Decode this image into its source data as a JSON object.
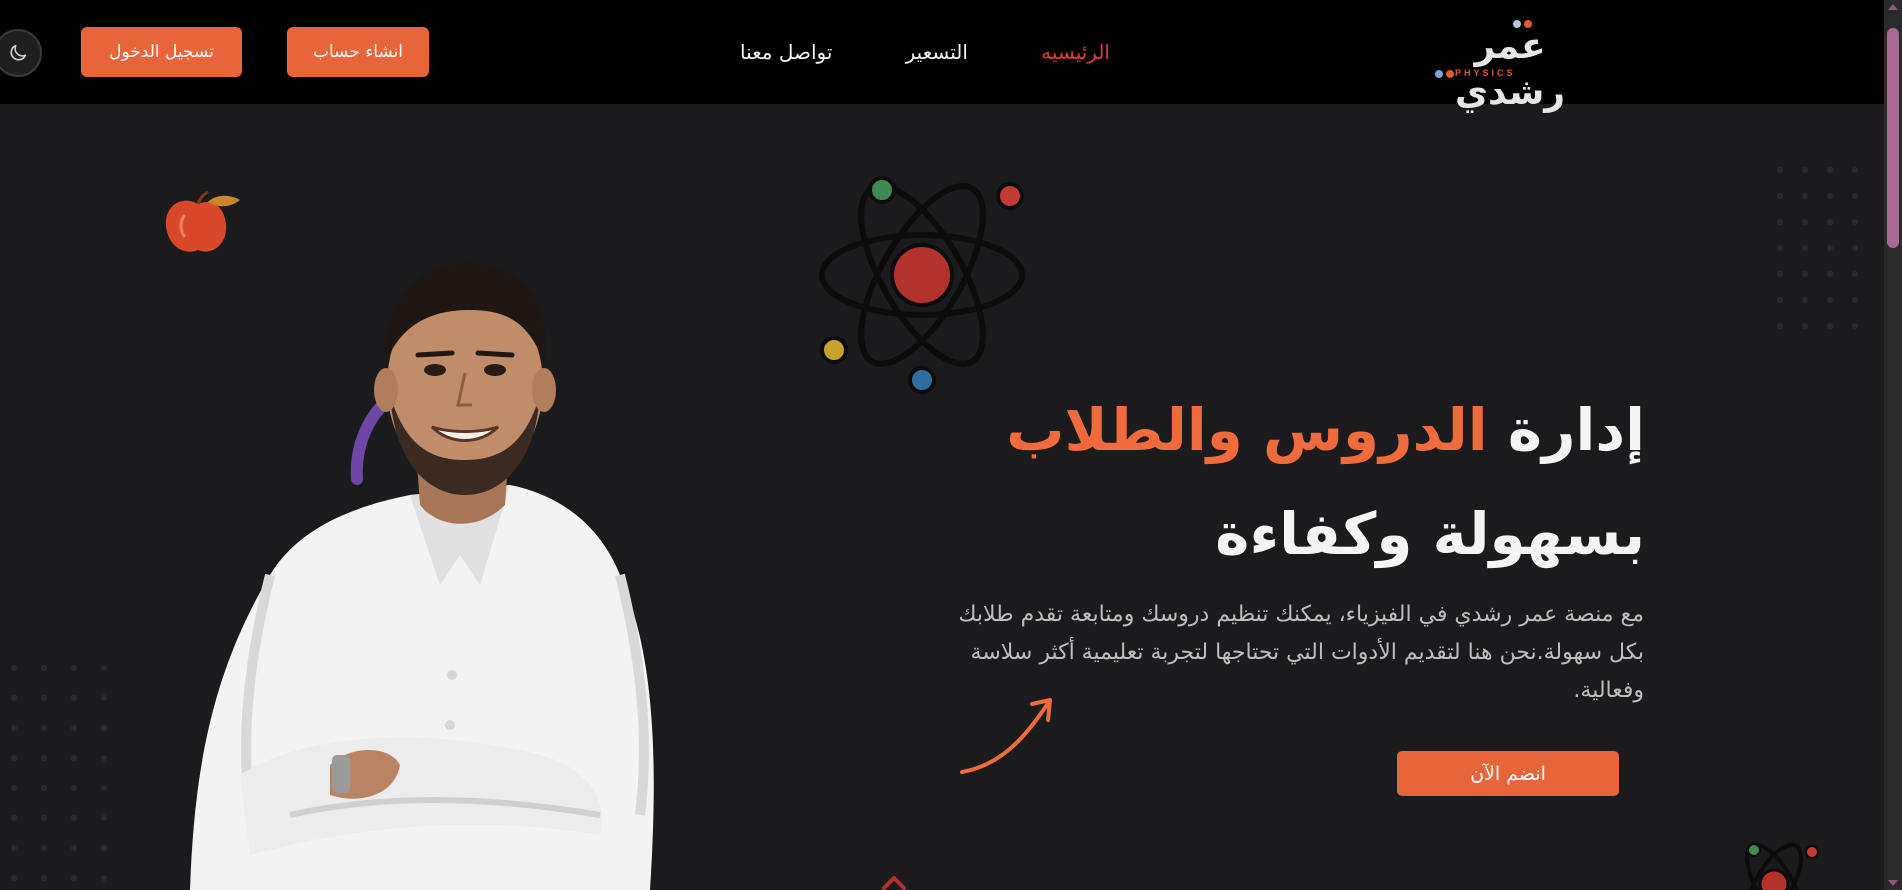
{
  "nav": {
    "logo_text": "عمر رشدي",
    "logo_subtitle": "PHYSICS",
    "links": [
      {
        "label": "الرئيسيه",
        "active": true
      },
      {
        "label": "التسعير",
        "active": false
      },
      {
        "label": "تواصل معنا",
        "active": false
      }
    ],
    "register_label": "انشاء حساب",
    "login_label": "تسجيل الدخول",
    "theme_icon": "moon-icon"
  },
  "hero": {
    "title_prefix": "إدارة",
    "title_accent": "الدروس والطلاب",
    "title_line2": "بسهولة وكفاءة",
    "description": "مع منصة عمر رشدي في الفيزياء، يمكنك تنظيم دروسك ومتابعة تقدم طلابك بكل سهولة.نحن هنا لتقديم الأدوات التي تحتاجها لتجربة تعليمية أكثر سلاسة وفعالية.",
    "cta_label": "انضم الآن",
    "portrait": "instructor-portrait"
  },
  "colors": {
    "accent": "#e8643a",
    "active_link": "#e53935",
    "background": "#1b1b1d",
    "navbar": "#000000"
  }
}
